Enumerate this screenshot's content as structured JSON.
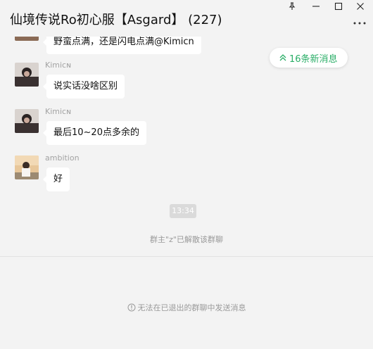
{
  "window": {
    "title": "仙境传说Ro初心服【Asgard】 (227)",
    "controls": [
      "pin-icon",
      "minimize-icon",
      "maximize-icon",
      "close-icon"
    ],
    "more_icon": "more-icon"
  },
  "new_messages": {
    "label": "16条新消息",
    "icon": "double-chevron-up-icon",
    "color": "#2aae67"
  },
  "messages": [
    {
      "sender": "",
      "text": "野蛮点满，还是闪电点满@Kimicn"
    },
    {
      "sender": "Kimicɴ",
      "text": "说实话没啥区别"
    },
    {
      "sender": "Kimicɴ",
      "text": "最后10~20点多余的"
    },
    {
      "sender": "ambition",
      "text": "好"
    }
  ],
  "timestamp": "13:34",
  "system_note": "群主\"z\"已解散该群聊",
  "input_disabled_note": "无法在已退出的群聊中发送消息",
  "colors": {
    "background": "#f3f3f3",
    "bubble": "#ffffff",
    "accent": "#2aae67"
  }
}
